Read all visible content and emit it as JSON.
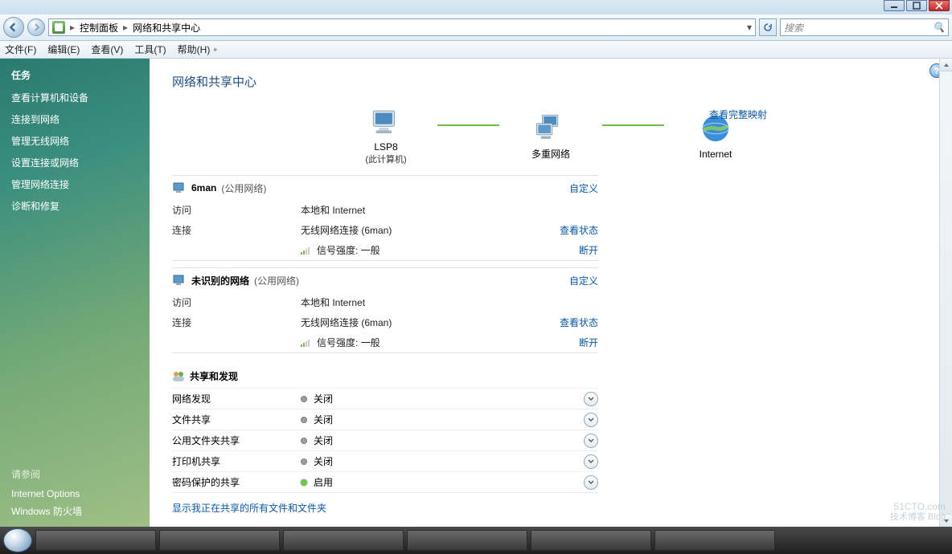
{
  "breadcrumb": {
    "item1": "控制面板",
    "item2": "网络和共享中心"
  },
  "search": {
    "placeholder": "搜索"
  },
  "menu": {
    "file": "文件(F)",
    "edit": "编辑(E)",
    "view": "查看(V)",
    "tools": "工具(T)",
    "help": "帮助(H)"
  },
  "sidebar": {
    "tasks_hdr": "任务",
    "tasks": [
      "查看计算机和设备",
      "连接到网络",
      "管理无线网络",
      "设置连接或网络",
      "管理网络连接",
      "诊断和修复"
    ],
    "seealso_hdr": "请参阅",
    "seealso": [
      "Internet Options",
      "Windows 防火墙"
    ]
  },
  "page_title": "网络和共享中心",
  "map": {
    "full_link": "查看完整映射",
    "node_pc": "LSP8",
    "node_pc_sub": "(此计算机)",
    "node_mid": "多重网络",
    "node_inet": "Internet"
  },
  "nets": [
    {
      "name": "6man",
      "paren": "(公用网络)",
      "customize": "自定义",
      "rows": [
        {
          "k": "访问",
          "v": "本地和 Internet"
        },
        {
          "k": "连接",
          "v": "无线网络连接 (6man)",
          "r": "查看状态"
        },
        {
          "k": "",
          "v": "信号强度:  一般",
          "sig": true,
          "r": "断开"
        }
      ]
    },
    {
      "name": "未识别的网络",
      "paren": "(公用网络)",
      "customize": "自定义",
      "rows": [
        {
          "k": "访问",
          "v": "本地和 Internet"
        },
        {
          "k": "连接",
          "v": "无线网络连接 (6man)",
          "r": "查看状态"
        },
        {
          "k": "",
          "v": "信号强度:  一般",
          "sig": true,
          "r": "断开"
        }
      ]
    }
  ],
  "share": {
    "hdr": "共享和发现",
    "rows": [
      {
        "k": "网络发现",
        "v": "关闭",
        "on": false
      },
      {
        "k": "文件共享",
        "v": "关闭",
        "on": false
      },
      {
        "k": "公用文件夹共享",
        "v": "关闭",
        "on": false
      },
      {
        "k": "打印机共享",
        "v": "关闭",
        "on": false
      },
      {
        "k": "密码保护的共享",
        "v": "启用",
        "on": true
      }
    ],
    "footer": "显示我正在共享的所有文件和文件夹"
  },
  "watermark": {
    "big": "51CTO.com",
    "small": "技术博客   Blog"
  }
}
